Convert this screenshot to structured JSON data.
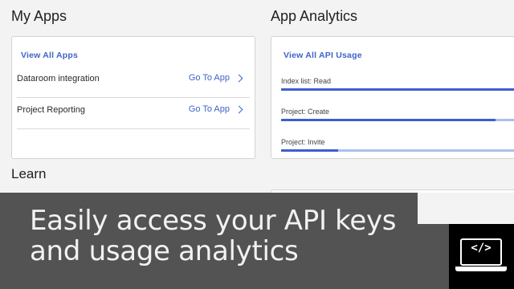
{
  "my_apps": {
    "title": "My Apps",
    "view_all_label": "View All Apps",
    "apps": [
      {
        "name": "Dataroom integration",
        "action": "Go To App"
      },
      {
        "name": "Project Reporting",
        "action": "Go To App"
      }
    ]
  },
  "analytics": {
    "title": "App Analytics",
    "view_all_label": "View All API Usage",
    "usage": [
      {
        "label": "Index list: Read",
        "fill_fraction": 1.0
      },
      {
        "label": "Project: Create",
        "fill_fraction": 0.9
      },
      {
        "label": "Project: Invite",
        "fill_fraction": 0.24
      }
    ]
  },
  "learn": {
    "title": "Learn"
  },
  "banner": {
    "line1": "Easily access your API keys",
    "line2": "and usage analytics",
    "badge_code": "</>"
  },
  "colors": {
    "accent": "#3f63c9",
    "bar_fill": "#3d5fcc",
    "bar_track": "#aac0ee",
    "banner_bg": "#535353"
  }
}
